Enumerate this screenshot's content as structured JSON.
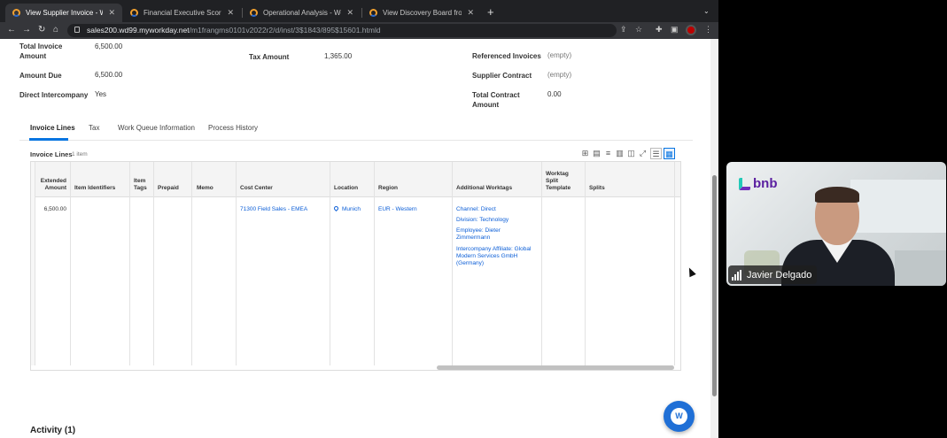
{
  "browser": {
    "tabs": [
      {
        "title": "View Supplier Invoice - Workday",
        "active": true
      },
      {
        "title": "Financial Executive Scorecard",
        "active": false
      },
      {
        "title": "Operational Analysis - Workday",
        "active": false
      },
      {
        "title": "View Discovery Board from Wo",
        "active": false
      }
    ],
    "url_host": "sales200.wd99.myworkday.net",
    "url_path": "/m1frangms0101v2022r2/d/inst/3$1843/895$15601.htmld"
  },
  "summary": {
    "col1": [
      {
        "label": "Total Invoice Amount",
        "value": "6,500.00"
      },
      {
        "label": "Amount Due",
        "value": "6,500.00"
      },
      {
        "label": "Direct Intercompany",
        "value": "Yes"
      }
    ],
    "col2": [
      {
        "label": "Tax Amount",
        "value": "1,365.00"
      }
    ],
    "col3": [
      {
        "label": "Referenced Invoices",
        "value": "(empty)"
      },
      {
        "label": "Supplier Contract",
        "value": "(empty)"
      },
      {
        "label": "Total Contract Amount",
        "value": "0.00"
      }
    ]
  },
  "page_tabs": [
    "Invoice Lines",
    "Tax",
    "Work Queue Information",
    "Process History"
  ],
  "invoice_lines": {
    "title": "Invoice Lines",
    "count": "1 item",
    "columns": [
      "Extended Amount",
      "Item Identifiers",
      "Item Tags",
      "Prepaid",
      "Memo",
      "Cost Center",
      "Location",
      "Region",
      "Additional Worktags",
      "Worktag Split Template",
      "Splits"
    ],
    "row": {
      "extended_amount": "6,500.00",
      "cost_center": "71300 Field Sales - EMEA",
      "location": "Munich",
      "region": "EUR - Western",
      "worktags": [
        "Channel: Direct",
        "Division: Technology",
        "Employee: Dieter Zimmermann",
        "Intercompany Affiliate: Global Modern Services GmbH (Germany)"
      ]
    }
  },
  "activity": {
    "title": "Activity (1)"
  },
  "video": {
    "participant": "Javier Delgado",
    "logo_text": "bnb"
  },
  "icons": [
    "lock-icon",
    "export-excel-icon",
    "export-pdf-icon",
    "filter-icon",
    "chart-icon",
    "columns-icon",
    "fullscreen-icon",
    "table-view-icon",
    "grid-view-icon",
    "location-pin-icon",
    "workday-assistant-icon"
  ]
}
